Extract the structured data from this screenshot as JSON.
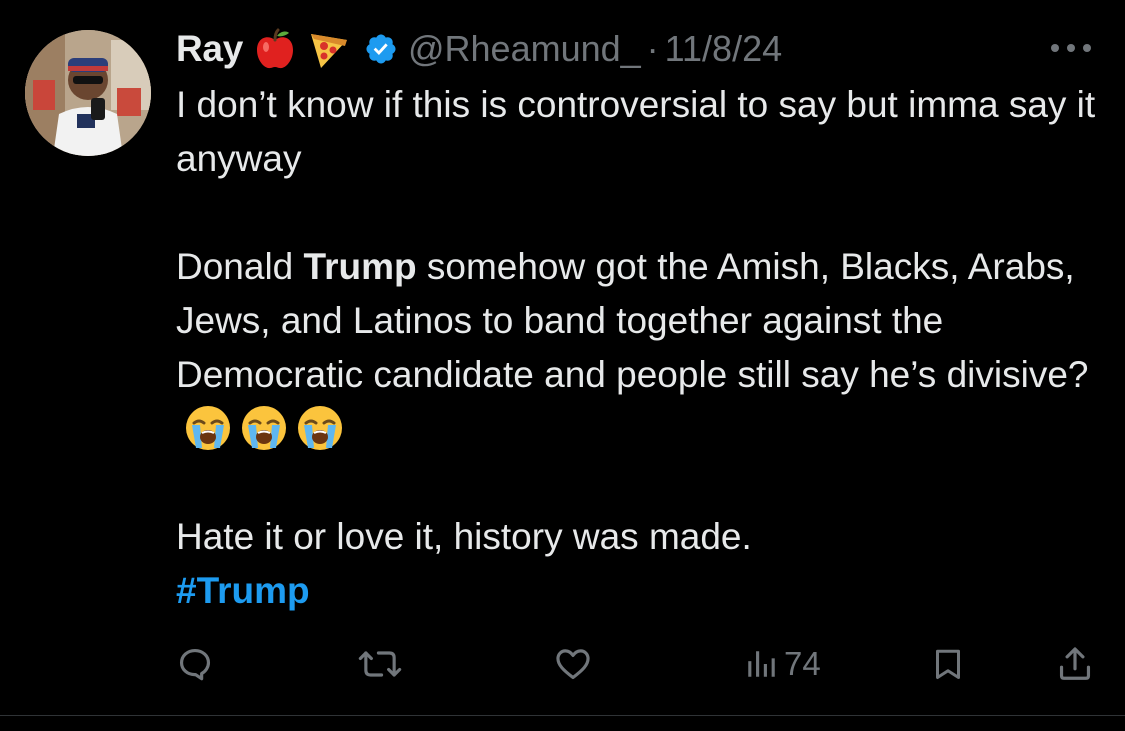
{
  "tweet": {
    "author_name": "Ray",
    "author_emojis": [
      "apple-emoji",
      "pizza-emoji"
    ],
    "verified": true,
    "handle": "@Rheamund_",
    "separator": "·",
    "date": "11/8/24",
    "text": {
      "line1": "I don’t know if this is controversial to say but imma say it anyway",
      "p2_before": "Donald ",
      "p2_bold": "Trump",
      "p2_after": " somehow got the Amish, Blacks, Arabs, Jews, and Latinos to band together against the Democratic candidate and people still say he’s divisive?",
      "p2_emojis": [
        "loudly-crying-face-emoji",
        "loudly-crying-face-emoji",
        "loudly-crying-face-emoji"
      ],
      "p3": "Hate it or love it, history was made.",
      "hashtag": "#Trump"
    },
    "actions": {
      "reply_icon": "reply-icon",
      "retweet_icon": "retweet-icon",
      "like_icon": "heart-icon",
      "views_icon": "views-icon",
      "views_count": "74",
      "bookmark_icon": "bookmark-icon",
      "share_icon": "share-icon"
    }
  },
  "colors": {
    "background": "#000000",
    "text": "#e7e9ea",
    "muted": "#71767b",
    "accent": "#1d9bf0"
  }
}
